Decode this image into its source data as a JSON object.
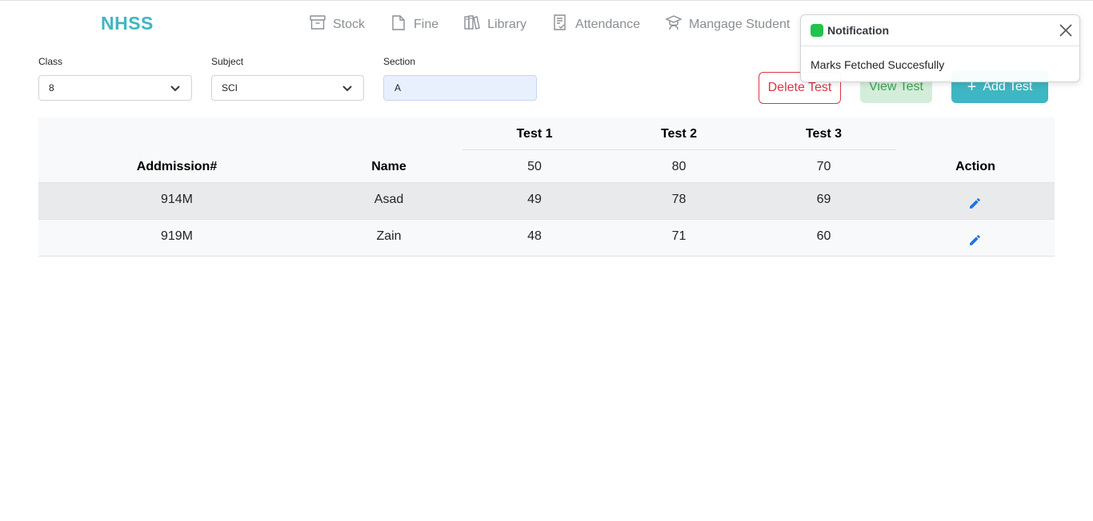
{
  "brand": "NHSS",
  "nav": [
    {
      "label": "Stock",
      "icon": "archive-icon"
    },
    {
      "label": "Fine",
      "icon": "file-icon"
    },
    {
      "label": "Library",
      "icon": "books-icon"
    },
    {
      "label": "Attendance",
      "icon": "checklist-icon"
    },
    {
      "label": "Mangage Student",
      "icon": "student-icon"
    }
  ],
  "filters": {
    "class_label": "Class",
    "class_value": "8",
    "subject_label": "Subject",
    "subject_value": "SCI",
    "section_label": "Section",
    "section_value": "A"
  },
  "buttons": {
    "delete": "Delete Test",
    "view": "View Test",
    "add": "Add Test"
  },
  "table": {
    "headers": {
      "admission": "Addmission#",
      "name": "Name",
      "test1": "Test 1",
      "test2": "Test 2",
      "test3": "Test 3",
      "action": "Action"
    },
    "max_marks": [
      "50",
      "80",
      "70"
    ],
    "rows": [
      {
        "admission": "914M",
        "name": "Asad",
        "t1": "49",
        "t2": "78",
        "t3": "69"
      },
      {
        "admission": "919M",
        "name": "Zain",
        "t1": "48",
        "t2": "71",
        "t3": "60"
      }
    ]
  },
  "notification": {
    "title": "Notification",
    "message": "Marks Fetched Succesfully",
    "status_color": "#20c34c"
  },
  "colors": {
    "brand": "#3fb6c3",
    "danger": "#dc3545",
    "success_soft": "#d4edda",
    "edit_icon": "#1a73e8"
  }
}
